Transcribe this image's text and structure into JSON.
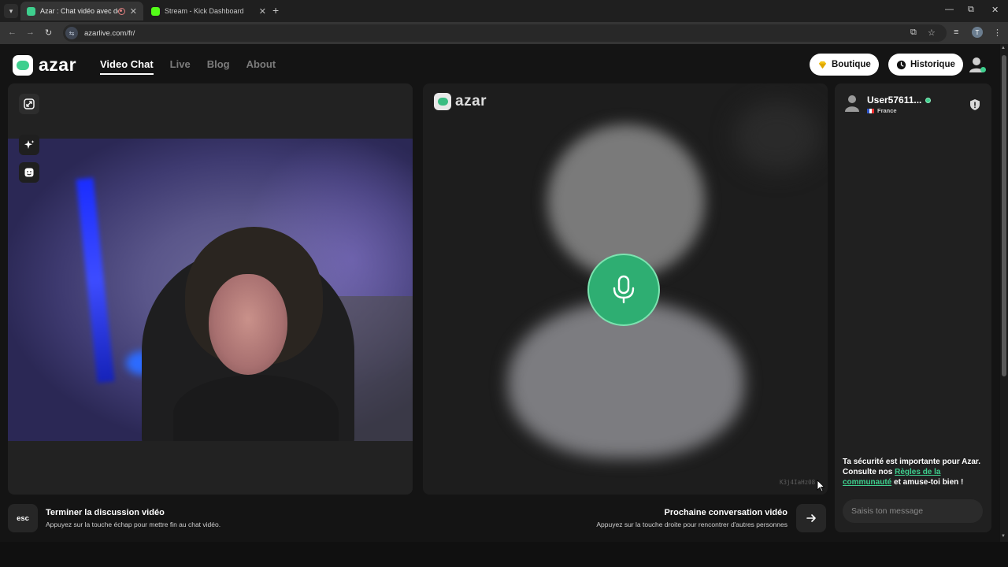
{
  "browser": {
    "tabs": [
      {
        "title": "Azar : Chat vidéo avec de r",
        "favicon_color": "#3ecf8e",
        "recording": true
      },
      {
        "title": "Stream - Kick Dashboard",
        "favicon_color": "#53fc18"
      }
    ],
    "url": "azarlive.com/fr/",
    "profile_initial": "T"
  },
  "header": {
    "logo_text": "azar",
    "nav": [
      {
        "label": "Video Chat",
        "active": true
      },
      {
        "label": "Live",
        "active": false
      },
      {
        "label": "Blog",
        "active": false
      },
      {
        "label": "About",
        "active": false
      }
    ],
    "boutique_label": "Boutique",
    "historique_label": "Historique"
  },
  "partner": {
    "logo_text": "azar",
    "id": "K3j4IaHz08",
    "status": "microphone-only"
  },
  "chat": {
    "username": "User57611...",
    "country": "France",
    "safety_prefix": "Ta sécurité est importante pour Azar. Consulte nos ",
    "safety_link": "Règles de la communauté",
    "safety_suffix": " et amuse-toi bien !",
    "input_placeholder": "Saisis ton message"
  },
  "actions": {
    "end": {
      "key": "esc",
      "title": "Terminer la discussion vidéo",
      "subtitle": "Appuyez sur la touche échap pour mettre fin au chat vidéo."
    },
    "next": {
      "title": "Prochaine conversation vidéo",
      "subtitle": "Appuyez sur la touche droite pour rencontrer d'autres personnes"
    }
  },
  "colors": {
    "accent_green": "#3ecf8e",
    "mic_green": "#2eae72",
    "background": "#141414",
    "card": "#222222"
  },
  "icons": [
    "tab-list-icon",
    "record-icon",
    "close-icon",
    "plus-icon",
    "minimize-icon",
    "restore-icon",
    "back-icon",
    "forward-icon",
    "reload-icon",
    "site-info-icon",
    "install-icon",
    "star-icon",
    "media-icon",
    "menu-icon",
    "expand-icon",
    "sparkle-icon",
    "face-filter-icon",
    "microphone-icon",
    "diamond-icon",
    "clock-icon",
    "user-icon",
    "shield-icon",
    "arrow-right-icon"
  ]
}
